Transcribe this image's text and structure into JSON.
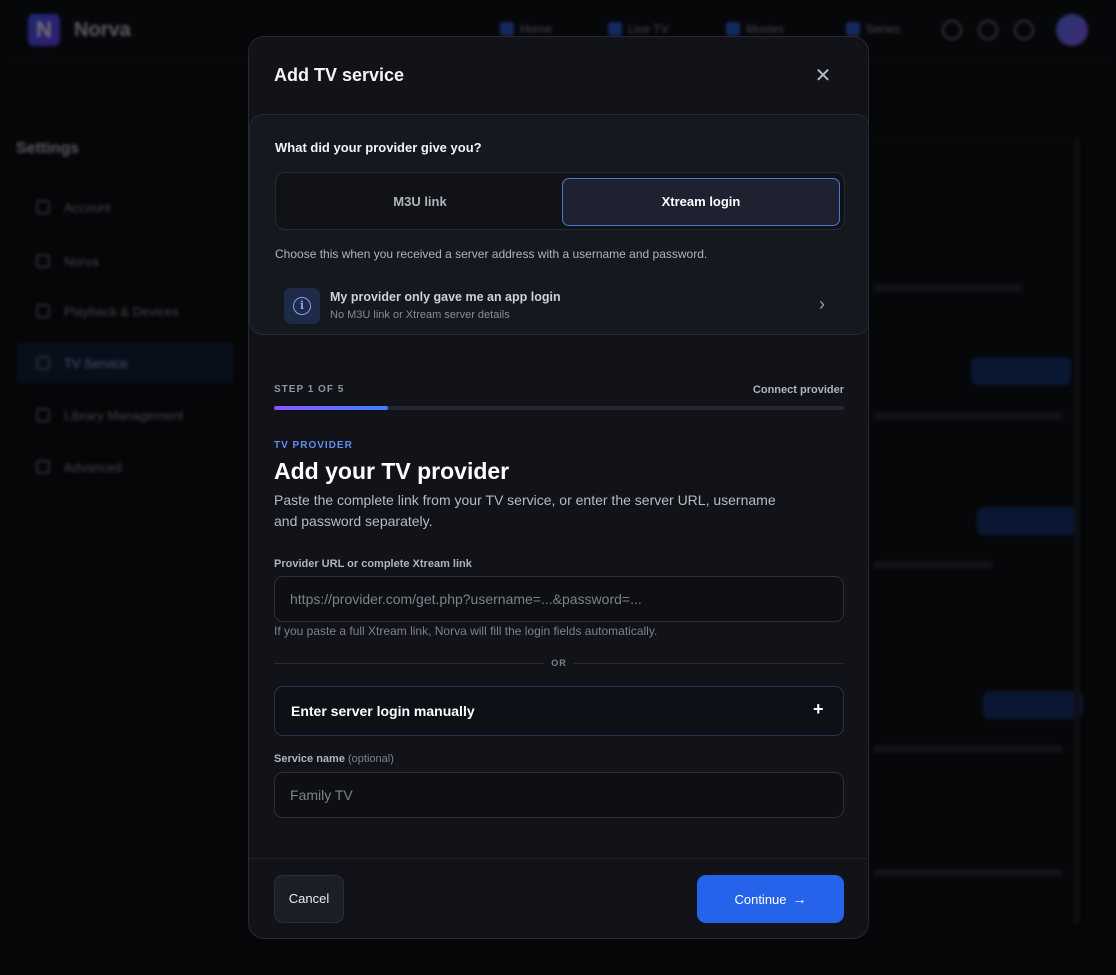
{
  "background": {
    "brand": "Norva",
    "nav": [
      "Home",
      "Live TV",
      "Movies",
      "Series"
    ],
    "sidebar_title": "Settings",
    "sidebar_items": [
      "Account",
      "Norva",
      "Playback & Devices",
      "TV Service",
      "Library Management",
      "Advanced"
    ]
  },
  "modal": {
    "title": "Add TV service",
    "close_glyph": "✕",
    "provider_question": "What did your provider give you?",
    "options": {
      "m3u": "M3U link",
      "xtream": "Xtream login"
    },
    "selected_option": "xtream",
    "option_help": "Choose this when you received a server address with a username and password.",
    "app_login": {
      "title": "My provider only gave me an app login",
      "subtitle": "No M3U link or Xtream server details",
      "icon_glyph": "i",
      "chevron_glyph": "›"
    },
    "step": {
      "label": "STEP 1 OF 5",
      "current": 1,
      "total": 5,
      "progress": 0.2,
      "name": "Connect provider"
    },
    "eyebrow": "TV PROVIDER",
    "heading": "Add your TV provider",
    "description": "Paste the complete link from your TV service, or enter the server URL, username and password separately.",
    "url_field": {
      "label": "Provider URL or complete Xtream link",
      "placeholder": "https://provider.com/get.php?username=...&password=...",
      "value": "",
      "hint": "If you paste a full Xtream link, Norva will fill the login fields automatically."
    },
    "divider_text": "OR",
    "manual_login": {
      "label": "Enter server login manually",
      "glyph": "+"
    },
    "service_name": {
      "label": "Service name",
      "optional": "(optional)",
      "placeholder": "Family TV",
      "value": ""
    },
    "cancel_label": "Cancel",
    "continue_label": "Continue",
    "continue_arrow": "→"
  },
  "colors": {
    "accent": "#2563eb",
    "selected_border": "#4a78d8",
    "eyebrow": "#5d8ef0",
    "modal_bg": "#111318",
    "page_bg": "#050608"
  }
}
